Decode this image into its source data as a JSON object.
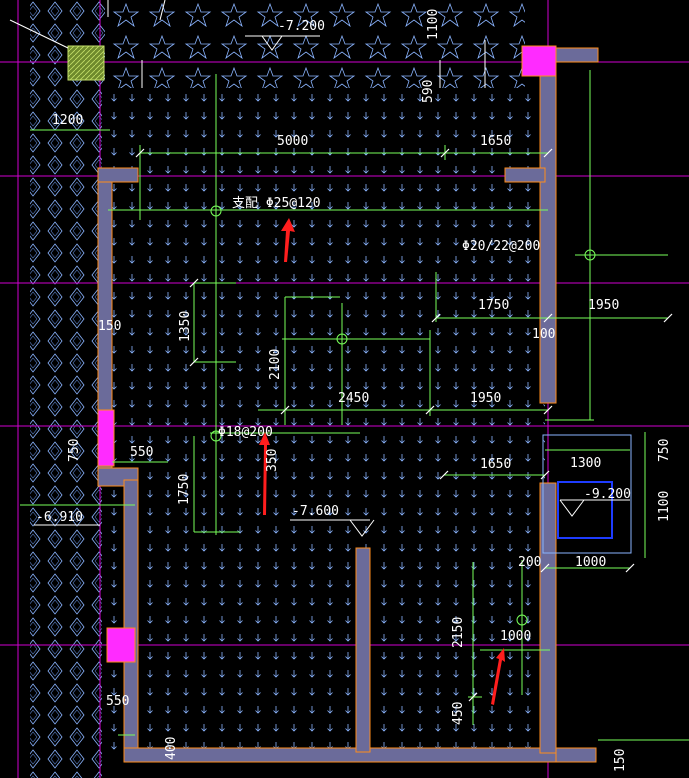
{
  "drawing": {
    "elevations": {
      "top": "-7.200",
      "mid": "-7.600",
      "pit": "-9.200",
      "left": "-6.910"
    },
    "rebar": {
      "main": "支配 Φ25@120",
      "secondary": "Φ20/22@200",
      "local": "Φ18@200"
    },
    "dims": {
      "d1100": "1100",
      "d590": "590",
      "d1200": "1200",
      "d5000": "5000",
      "d1650a": "1650",
      "d1350": "1350",
      "d1750a": "1750",
      "d1950a": "1950",
      "d150": "150",
      "d100": "100",
      "d2100": "2100",
      "d2450": "2450",
      "d1950b": "1950",
      "d750a": "750",
      "d550a": "550",
      "d350": "350",
      "d1750b": "1750",
      "d1650b": "1650",
      "d1300": "1300",
      "d750b": "750",
      "d1100b": "1100",
      "d200": "200",
      "d1000a": "1000",
      "d2150": "2150",
      "d1000b": "1000",
      "d450": "450",
      "d550b": "550",
      "d400": "400",
      "d150b": "150"
    },
    "colors": {
      "background": "#000000",
      "dimension": "#78ff5a",
      "gridline": "#d000d0",
      "wall_fill": "#6b6b9a",
      "wall_edge": "#ff8c1a",
      "column": "#ff2bff",
      "hatch": "#8ab4ff",
      "annotation_arrow": "#ff1e1e",
      "pit_outline": "#1e3cff"
    }
  }
}
